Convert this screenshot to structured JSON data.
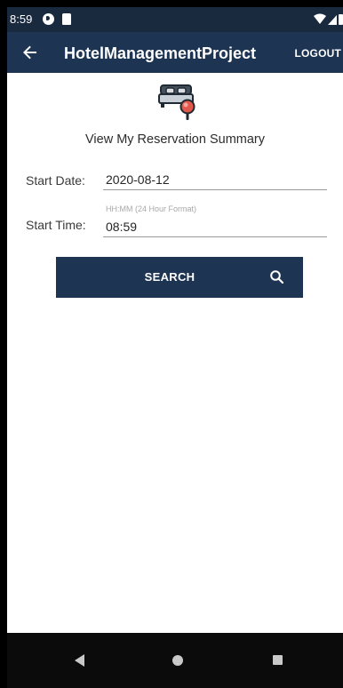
{
  "status_bar": {
    "time": "8:59"
  },
  "app_bar": {
    "title": "HotelManagementProject",
    "logout_label": "LOGOUT"
  },
  "content": {
    "heading": "View My Reservation Summary",
    "start_date": {
      "label": "Start Date:",
      "value": "2020-08-12"
    },
    "start_time": {
      "label": "Start Time:",
      "hint": "HH:MM (24 Hour Format)",
      "value": "08:59"
    },
    "search_button": {
      "label": "SEARCH"
    }
  },
  "icons": {
    "back": "arrow-left-icon",
    "hero": "bed-search-icon",
    "search": "magnifier-icon",
    "nav_back": "triangle-back-icon",
    "nav_home": "circle-home-icon",
    "nav_recents": "square-recents-icon"
  },
  "colors": {
    "status_bar": "#1a2a3e",
    "primary": "#1d3553",
    "accent": "#e1584a",
    "text": "#2c2c2c"
  }
}
